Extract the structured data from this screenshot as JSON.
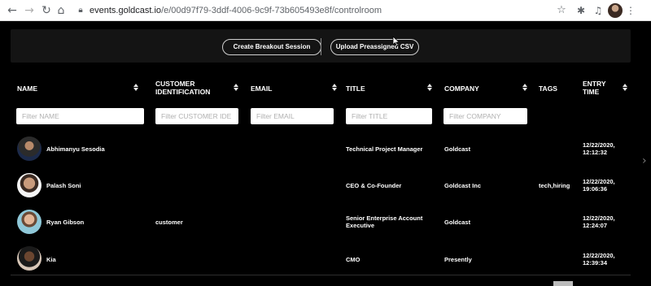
{
  "browser": {
    "url_host": "events.goldcast.io",
    "url_path": "/e/00d97f79-3ddf-4006-9c9f-73b605493e8f/controlroom",
    "icons": [
      "back-icon",
      "forward-icon",
      "reload-icon",
      "home-icon",
      "lock-icon",
      "star-icon",
      "extensions-icon",
      "media-icon",
      "profile-avatar",
      "menu-icon"
    ]
  },
  "toolbar": {
    "create_breakout": "Create Breakout Session",
    "upload_csv": "Upload Preassigned CSV"
  },
  "table": {
    "headers": {
      "name": "NAME",
      "customer_id": "CUSTOMER IDENTIFICATION",
      "email": "EMAIL",
      "title": "TITLE",
      "company": "COMPANY",
      "tags": "TAGS",
      "entry_time": "ENTRY TIME"
    },
    "filters": {
      "name": "Filter NAME",
      "customer_id": "Filter CUSTOMER IDE",
      "email": "Filter EMAIL",
      "title": "Filter TITLE",
      "company": "Filter COMPANY"
    },
    "rows": [
      {
        "name": "Abhimanyu Sesodia",
        "customer_id": "",
        "email": "",
        "title": "Technical Project Manager",
        "company": "Goldcast",
        "tags": "",
        "entry_time": "12/22/2020, 12:12:32"
      },
      {
        "name": "Palash Soni",
        "customer_id": "",
        "email": "",
        "title": "CEO & Co-Founder",
        "company": "Goldcast Inc",
        "tags": "tech,hiring",
        "entry_time": "12/22/2020, 19:06:36"
      },
      {
        "name": "Ryan Gibson",
        "customer_id": "customer",
        "email": "",
        "title": "Senior Enterprise Account Executive",
        "company": "Goldcast",
        "tags": "",
        "entry_time": "12/22/2020, 12:24:07"
      },
      {
        "name": "Kia",
        "customer_id": "",
        "email": "",
        "title": "CMO",
        "company": "Presently",
        "tags": "",
        "entry_time": "12/22/2020, 12:39:34"
      }
    ]
  }
}
